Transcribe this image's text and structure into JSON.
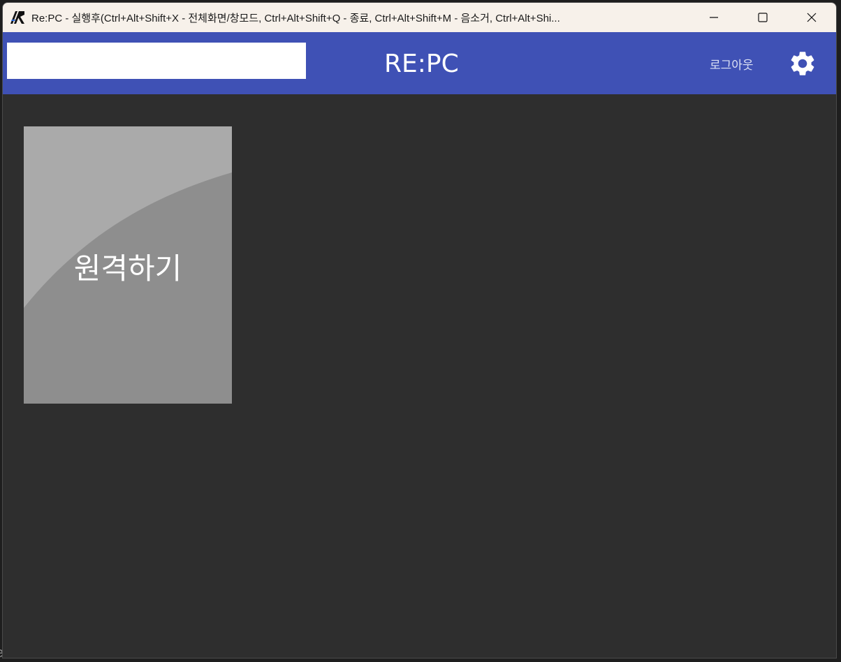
{
  "window": {
    "title": "Re:PC - 실행후(Ctrl+Alt+Shift+X - 전체화면/창모드, Ctrl+Alt+Shift+Q - 종료, Ctrl+Alt+Shift+M - 음소거, Ctrl+Alt+Shi...",
    "app_icon": "repc-logo-icon",
    "controls": {
      "minimize_icon": "minimize-icon",
      "maximize_icon": "maximize-icon",
      "close_icon": "close-icon"
    }
  },
  "appbar": {
    "search_value": "",
    "title": "RE:PC",
    "logout_label": "로그아웃",
    "settings_icon": "gear-icon",
    "color": "#3f51b5"
  },
  "main": {
    "tiles": [
      {
        "label": "원격하기",
        "color": "#8e8e8e"
      }
    ]
  },
  "background": {
    "partial_text": "ences"
  }
}
